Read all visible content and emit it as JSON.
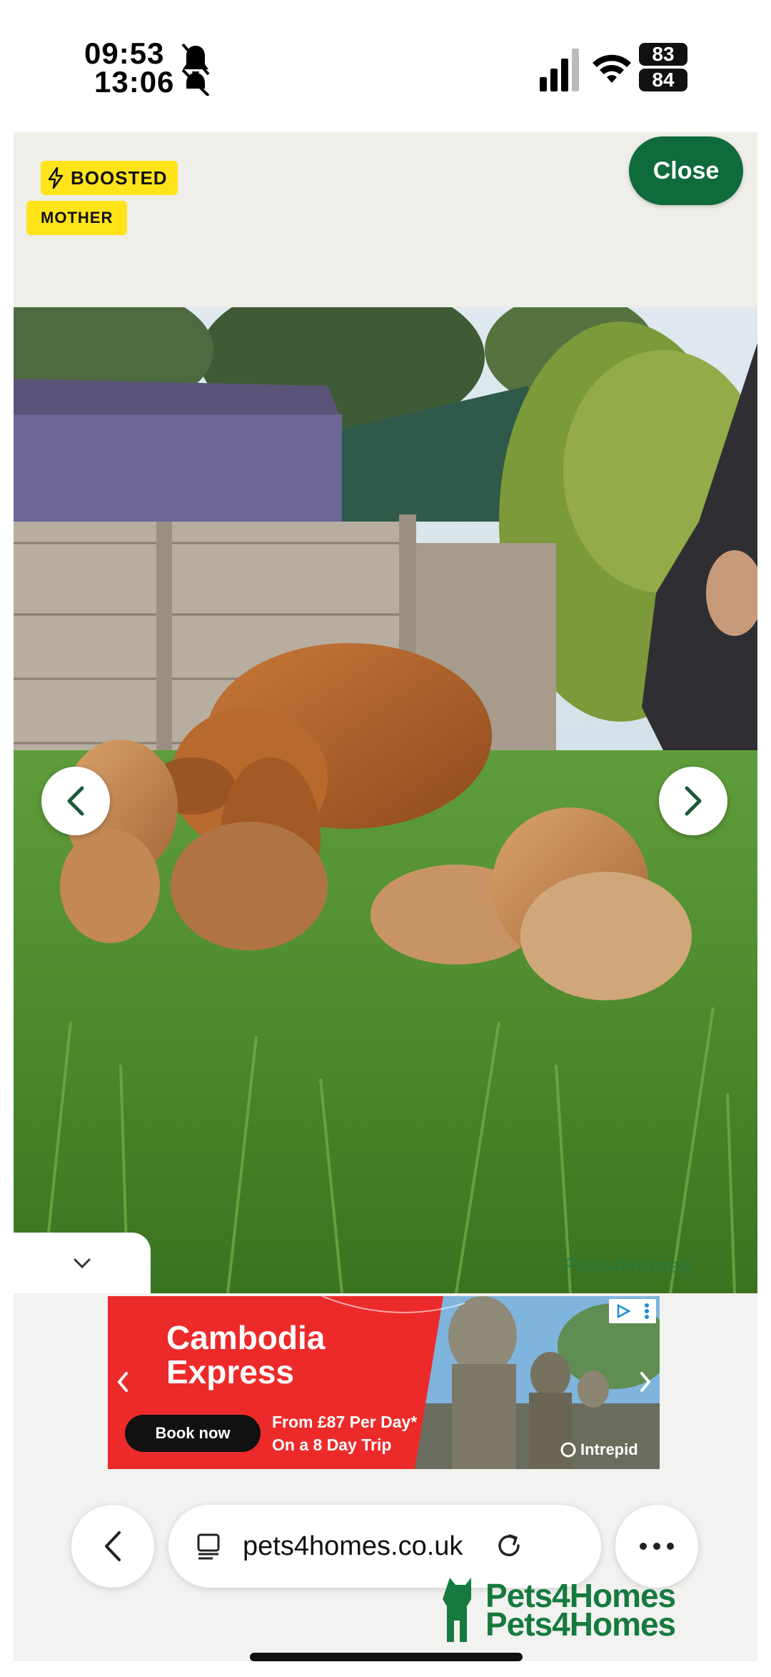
{
  "status_bar": {
    "time_primary": "09:53",
    "time_secondary": "13:06",
    "battery_primary": "83",
    "battery_secondary": "84",
    "icons": [
      "bell-muted-icon",
      "signal-icon",
      "wifi-icon",
      "battery-icon"
    ]
  },
  "viewer": {
    "badges": {
      "boosted": "BOOSTED",
      "mother": "MOTHER"
    },
    "close_label": "Close",
    "photo_watermark": "Pets4Homes",
    "nav": {
      "prev_icon": "chevron-left-icon",
      "next_icon": "chevron-right-icon"
    }
  },
  "ad": {
    "title_line1": "Cambodia",
    "title_line2": "Express",
    "cta": "Book now",
    "offer_line1": "From £87 Per Day*",
    "offer_line2": "On a 8 Day Trip",
    "brand": "Intrepid"
  },
  "browser": {
    "url": "pets4homes.co.uk",
    "icons": [
      "back-chevron-icon",
      "reader-icon",
      "reload-icon",
      "more-dots-icon"
    ]
  },
  "brand_overlay": {
    "line1": "Pets4Homes",
    "line2": "Pets4Homes"
  },
  "colors": {
    "brand_green": "#0f6b3c",
    "badge_yellow": "#ffe41a",
    "ad_red": "#ed2a2a"
  }
}
